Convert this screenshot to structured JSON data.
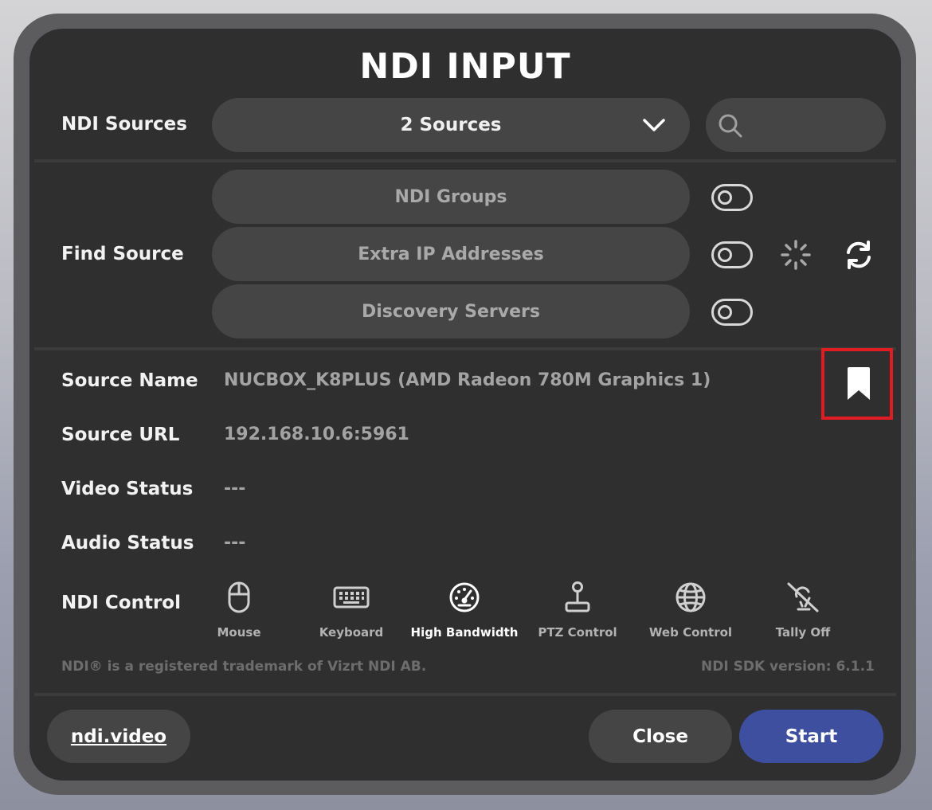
{
  "dialog": {
    "title": "NDI INPUT"
  },
  "sources": {
    "label": "NDI Sources",
    "selected": "2 Sources",
    "search_placeholder": ""
  },
  "find": {
    "label": "Find Source",
    "groups_placeholder": "NDI Groups",
    "ips_placeholder": "Extra IP Addresses",
    "servers_placeholder": "Discovery Servers"
  },
  "details": {
    "name_label": "Source Name",
    "name_value": "NUCBOX_K8PLUS (AMD Radeon 780M Graphics 1)",
    "url_label": "Source URL",
    "url_value": "192.168.10.6:5961",
    "video_label": "Video Status",
    "video_value": "---",
    "audio_label": "Audio Status",
    "audio_value": "---"
  },
  "control": {
    "label": "NDI Control",
    "items": [
      {
        "label": "Mouse",
        "icon": "mouse-icon"
      },
      {
        "label": "Keyboard",
        "icon": "keyboard-icon"
      },
      {
        "label": "High Bandwidth",
        "icon": "gauge-icon"
      },
      {
        "label": "PTZ Control",
        "icon": "joystick-icon"
      },
      {
        "label": "Web Control",
        "icon": "globe-icon"
      },
      {
        "label": "Tally Off",
        "icon": "tally-off-icon"
      }
    ]
  },
  "footer": {
    "trademark": "NDI® is a registered trademark of Vizrt NDI AB.",
    "sdk_version": "NDI SDK version:  6.1.1",
    "link": "ndi.video",
    "close": "Close",
    "start": "Start"
  },
  "colors": {
    "panel": "#2f2f2f",
    "pill": "#454545",
    "start_button": "#3d4f9e",
    "highlight": "#e11d23"
  }
}
